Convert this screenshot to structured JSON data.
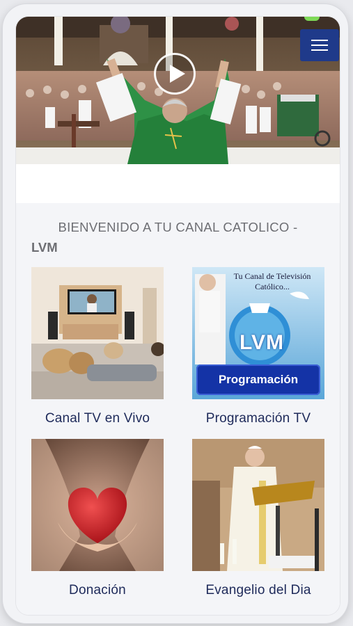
{
  "welcome": {
    "line1": "BIENVENIDO A TU CANAL CATOLICO -",
    "line2": "LVM"
  },
  "cards": [
    {
      "label": "Canal TV en Vivo"
    },
    {
      "label": "Programación TV",
      "tagline": "Tu Canal de Televisión Católico...",
      "logo": "LVM",
      "banner": "Programación"
    },
    {
      "label": "Donación"
    },
    {
      "label": "Evangelio del Dia"
    }
  ],
  "icons": {
    "play": "play-icon",
    "menu": "hamburger-menu-icon"
  },
  "colors": {
    "menu_bg": "#1f3a8a",
    "label_text": "#1e2a5a",
    "heading_text": "#6d6e73"
  }
}
